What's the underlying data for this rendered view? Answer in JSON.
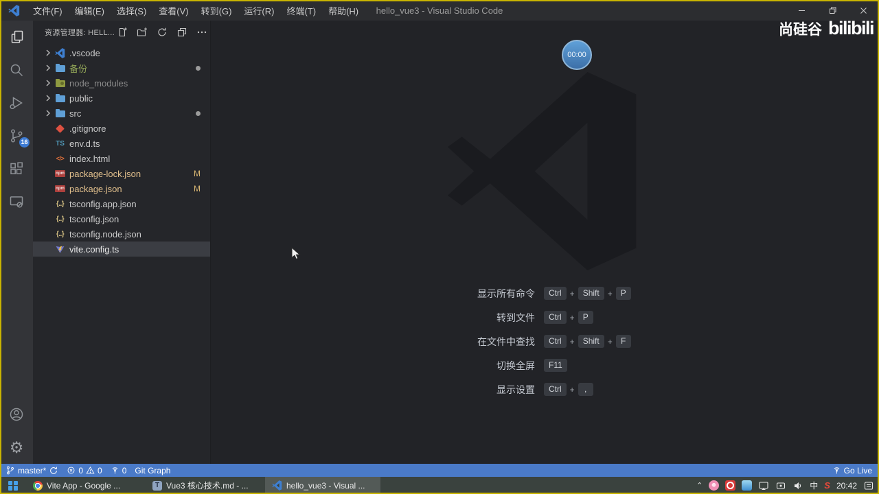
{
  "colors": {
    "status_bar_bg": "#4a7ac8",
    "recording_border": "#c9b400",
    "taskbar_bg": "#3a423e",
    "modified_file": "#e2c08d",
    "untracked_folder": "#93a758"
  },
  "window": {
    "title": "hello_vue3 - Visual Studio Code",
    "menus": [
      "文件(F)",
      "编辑(E)",
      "选择(S)",
      "查看(V)",
      "转到(G)",
      "运行(R)",
      "终端(T)",
      "帮助(H)"
    ]
  },
  "activity_bar": {
    "source_control_badge": "16"
  },
  "explorer": {
    "title": "资源管理器: HELL...",
    "files": [
      {
        "name": ".vscode",
        "icon": "vscode",
        "folder": true,
        "badge": ""
      },
      {
        "name": "备份",
        "icon": "folder",
        "folder": true,
        "color": "#93a758",
        "badge": "dot"
      },
      {
        "name": "node_modules",
        "icon": "folder-node",
        "folder": true,
        "color": "#8b8b8b",
        "badge": ""
      },
      {
        "name": "public",
        "icon": "folder",
        "folder": true,
        "badge": ""
      },
      {
        "name": "src",
        "icon": "folder",
        "folder": true,
        "badge": "dot"
      },
      {
        "name": ".gitignore",
        "icon": "git",
        "folder": false,
        "badge": ""
      },
      {
        "name": "env.d.ts",
        "icon": "ts",
        "folder": false,
        "badge": ""
      },
      {
        "name": "index.html",
        "icon": "html",
        "folder": false,
        "badge": ""
      },
      {
        "name": "package-lock.json",
        "icon": "npm",
        "folder": false,
        "color": "#e2c08d",
        "badge": "M"
      },
      {
        "name": "package.json",
        "icon": "npm",
        "folder": false,
        "color": "#e2c08d",
        "badge": "M"
      },
      {
        "name": "tsconfig.app.json",
        "icon": "brace",
        "folder": false,
        "badge": ""
      },
      {
        "name": "tsconfig.json",
        "icon": "brace",
        "folder": false,
        "badge": ""
      },
      {
        "name": "tsconfig.node.json",
        "icon": "brace",
        "folder": false,
        "badge": ""
      },
      {
        "name": "vite.config.ts",
        "icon": "vite",
        "folder": false,
        "badge": "",
        "selected": true
      }
    ]
  },
  "editor": {
    "shortcuts": [
      {
        "label": "显示所有命令",
        "keys": [
          "Ctrl",
          "Shift",
          "P"
        ]
      },
      {
        "label": "转到文件",
        "keys": [
          "Ctrl",
          "P"
        ]
      },
      {
        "label": "在文件中查找",
        "keys": [
          "Ctrl",
          "Shift",
          "F"
        ]
      },
      {
        "label": "切换全屏",
        "keys": [
          "F11"
        ]
      },
      {
        "label": "显示设置",
        "keys": [
          "Ctrl",
          ","
        ]
      }
    ]
  },
  "overlay": {
    "timer": "00:00",
    "brand_cn": "尚硅谷",
    "brand_en": "bilibili"
  },
  "status_bar": {
    "branch": "master*",
    "errors": "0",
    "warnings": "0",
    "ports": "0",
    "git_graph": "Git Graph",
    "go_live": "Go Live"
  },
  "taskbar": {
    "tasks": [
      {
        "label": "Vite App - Google ...",
        "icon": "chrome",
        "active": false
      },
      {
        "label": "Vue3 核心技术.md - ...",
        "icon": "typora",
        "active": false
      },
      {
        "label": "hello_vue3 - Visual ...",
        "icon": "vscode",
        "active": true
      }
    ],
    "ime": "中",
    "sogou": "S",
    "clock": "20:42"
  }
}
